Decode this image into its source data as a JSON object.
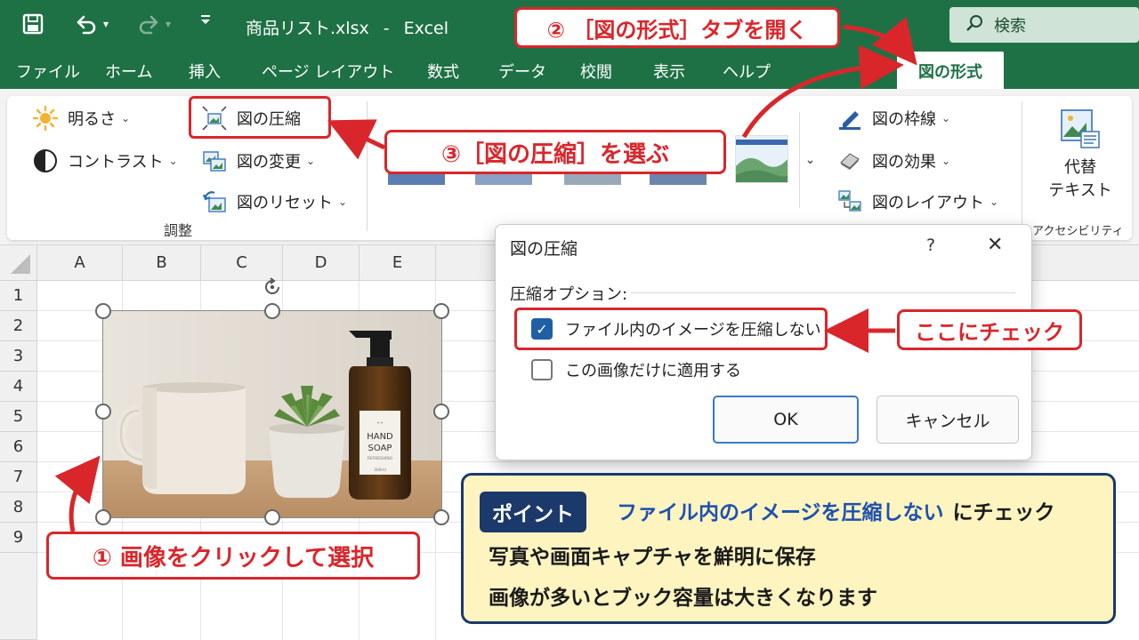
{
  "titlebar": {
    "filename": "商品リスト.xlsx",
    "app": "Excel",
    "search_label": "検索"
  },
  "tabs": [
    "ファイル",
    "ホーム",
    "挿入",
    "ページ レイアウト",
    "数式",
    "データ",
    "校閲",
    "表示",
    "ヘルプ"
  ],
  "active_tab": "図の形式",
  "ribbon": {
    "brightness": "明るさ",
    "contrast": "コントラスト",
    "compress": "図の圧縮",
    "change": "図の変更",
    "reset": "図のリセット",
    "adjust_group": "調整",
    "border": "図の枠線",
    "effects": "図の効果",
    "layout": "図のレイアウト",
    "alt_text_line1": "代替",
    "alt_text_line2": "テキスト",
    "accessibility_group": "アクセシビリティ"
  },
  "columns": [
    "A",
    "B",
    "C",
    "D",
    "E"
  ],
  "rows": [
    "1",
    "2",
    "3",
    "4",
    "5",
    "6",
    "7",
    "8",
    "9"
  ],
  "picture": {
    "label_line1": "HAND",
    "label_line2": "SOAP",
    "label_line3": "REFRESHING",
    "label_line4": "300ml"
  },
  "dialog": {
    "title": "図の圧縮",
    "help": "?",
    "close": "✕",
    "section": "圧縮オプション:",
    "option1": "ファイル内のイメージを圧縮しない",
    "option1_checked": true,
    "option2": "この画像だけに適用する",
    "option2_checked": false,
    "ok": "OK",
    "cancel": "キャンセル"
  },
  "callouts": {
    "step1": "① 画像をクリックして選択",
    "step2": "② ［図の形式］タブを開く",
    "step3": "③［図の圧縮］を選ぶ",
    "check": "ここにチェック"
  },
  "point": {
    "badge": "ポイント",
    "highlight": "ファイル内のイメージを圧縮しない",
    "line1_suffix": "にチェック",
    "line2": "写真や画面キャプチャを鮮明に保存",
    "line3": "画像が多いとブック容量は大きくなります"
  },
  "colors": {
    "excel_green": "#1e7145",
    "callout_red": "#d9262b",
    "point_navy": "#1b3a6b",
    "point_bg": "#fdf4c0",
    "point_blue": "#1e50b0"
  }
}
